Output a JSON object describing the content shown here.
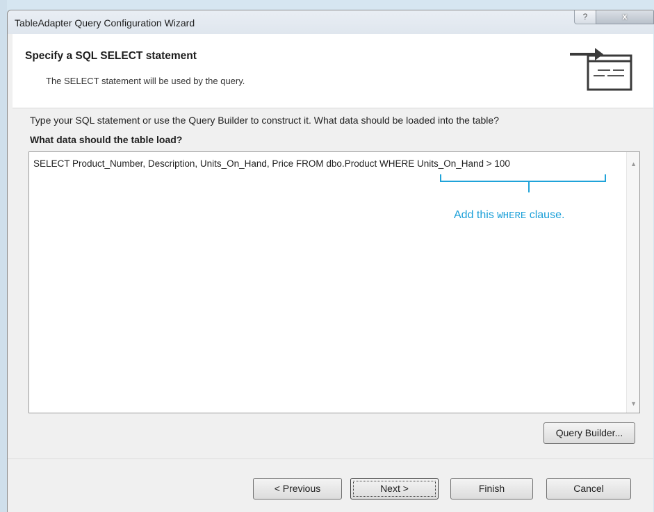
{
  "window": {
    "title": "TableAdapter Query Configuration Wizard",
    "help_label": "?",
    "close_label": "x"
  },
  "header": {
    "title": "Specify a SQL SELECT statement",
    "subtitle": "The SELECT statement will be used by the query."
  },
  "body": {
    "instruction": "Type your SQL statement or use the Query Builder to construct it. What data should be loaded into the table?",
    "question": "What data should the table load?",
    "sql_text": "SELECT Product_Number, Description, Units_On_Hand, Price FROM dbo.Product WHERE Units_On_Hand > 100",
    "annotation_prefix": "Add this ",
    "annotation_code": "WHERE",
    "annotation_suffix": " clause."
  },
  "buttons": {
    "query_builder": "Query Builder...",
    "previous": "< Previous",
    "next": "Next >",
    "finish": "Finish",
    "cancel": "Cancel"
  },
  "icons": {
    "wizard": "sql-statement-arrow-icon",
    "scroll_up": "chevron-up-icon",
    "scroll_down": "chevron-down-icon"
  },
  "colors": {
    "annotation": "#1a9fd8",
    "window_bg": "#f0f0f0"
  }
}
